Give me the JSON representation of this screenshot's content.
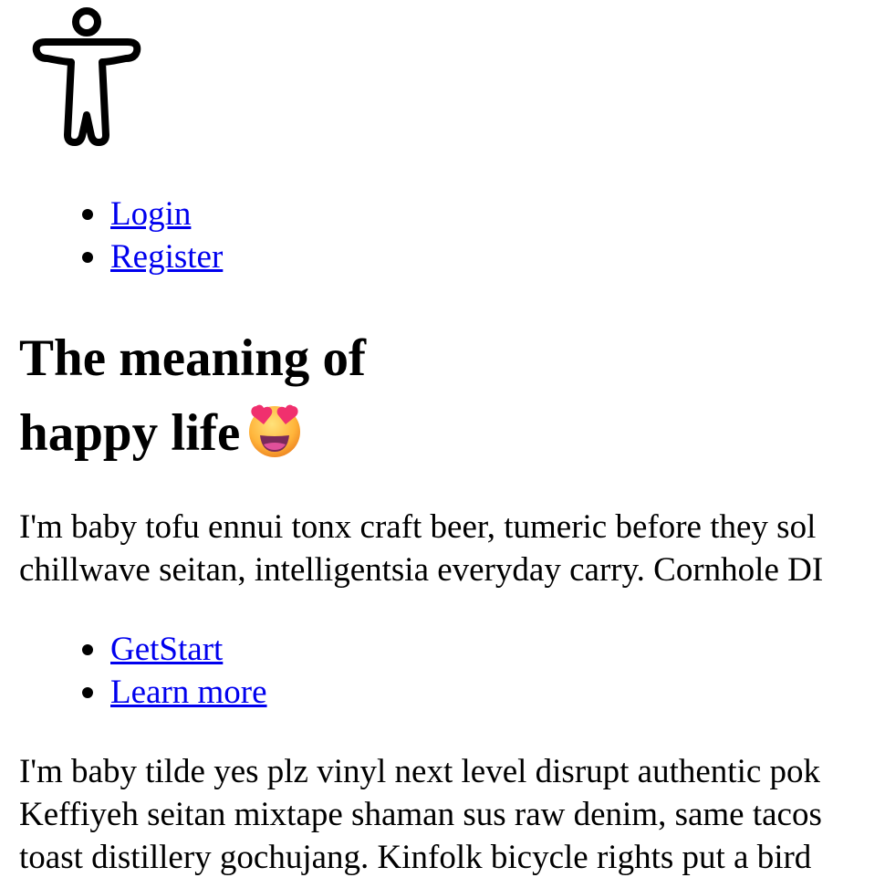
{
  "logo": {
    "icon": "accessibility-person-icon"
  },
  "nav": {
    "items": [
      {
        "label": "Login"
      },
      {
        "label": "Register"
      }
    ]
  },
  "hero": {
    "title_line1": "The meaning of",
    "title_line2": "happy life",
    "emoji_icon": "star-struck-emoji-icon"
  },
  "content": {
    "paragraph1": [
      "I'm baby tofu ennui tonx craft beer, tumeric before they sol",
      "chillwave seitan, intelligentsia everyday carry. Cornhole DI"
    ],
    "actions": [
      {
        "label": "GetStart"
      },
      {
        "label": "Learn more"
      }
    ],
    "paragraph2": [
      "I'm baby tilde yes plz vinyl next level disrupt authentic pok",
      "Keffiyeh seitan mixtape shaman sus raw denim, same tacos",
      "toast distillery gochujang. Kinfolk bicycle rights put a bird"
    ]
  },
  "colors": {
    "link": "#0000ee",
    "text": "#000000",
    "background": "#ffffff"
  }
}
